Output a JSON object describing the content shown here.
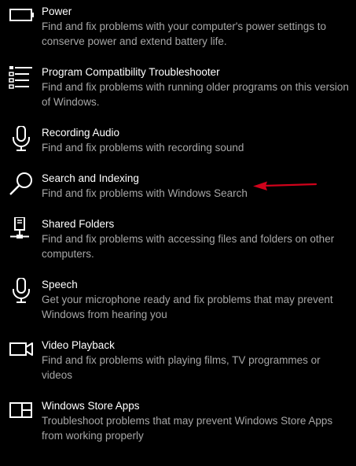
{
  "items": [
    {
      "icon": "battery-icon",
      "title": "Power",
      "description": "Find and fix problems with your computer's power settings to conserve power and extend battery life."
    },
    {
      "icon": "list-icon",
      "title": "Program Compatibility Troubleshooter",
      "description": "Find and fix problems with running older programs on this version of Windows."
    },
    {
      "icon": "microphone-icon",
      "title": "Recording Audio",
      "description": "Find and fix problems with recording sound"
    },
    {
      "icon": "search-icon",
      "title": "Search and Indexing",
      "description": "Find and fix problems with Windows Search"
    },
    {
      "icon": "network-folder-icon",
      "title": "Shared Folders",
      "description": "Find and fix problems with accessing files and folders on other computers."
    },
    {
      "icon": "microphone-icon",
      "title": "Speech",
      "description": "Get your microphone ready and fix problems that may prevent Windows from hearing you"
    },
    {
      "icon": "video-camera-icon",
      "title": "Video Playback",
      "description": "Find and fix problems with playing films, TV programmes or videos"
    },
    {
      "icon": "store-apps-icon",
      "title": "Windows Store Apps",
      "description": "Troubleshoot problems that may prevent Windows Store Apps from working properly"
    }
  ],
  "annotation": {
    "color": "#d0021b"
  },
  "colors": {
    "background": "#000000",
    "title": "#ffffff",
    "description": "#a6a6a6"
  }
}
